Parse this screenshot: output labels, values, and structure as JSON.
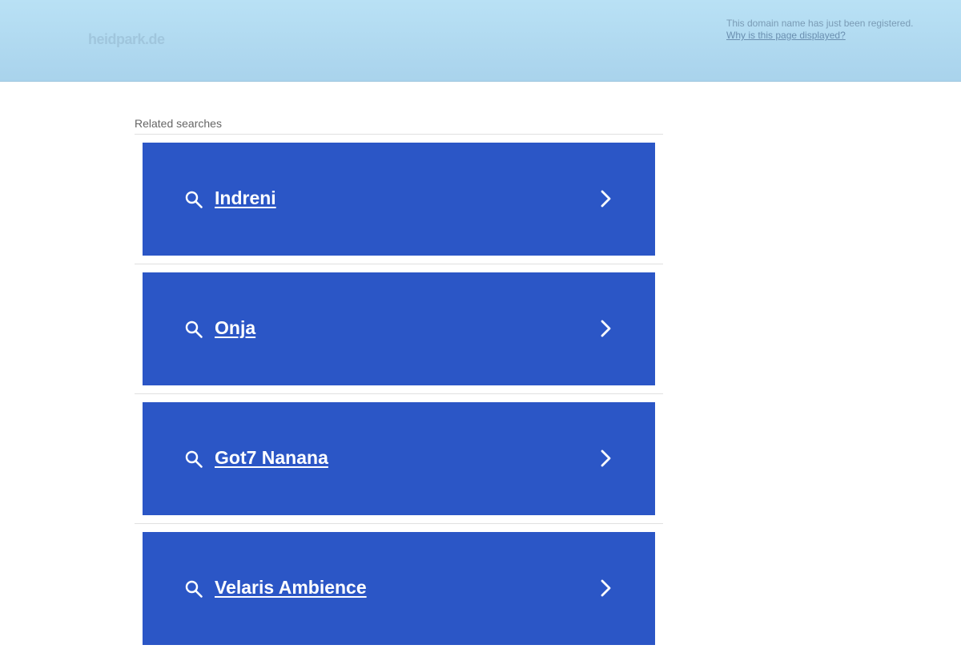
{
  "header": {
    "domain": "heidpark.de",
    "notice": "This domain name has just been registered.",
    "why_link": "Why is this page displayed?"
  },
  "related": {
    "title": "Related searches",
    "items": [
      {
        "label": "Indreni"
      },
      {
        "label": "Onja"
      },
      {
        "label": "Got7 Nanana"
      },
      {
        "label": "Velaris Ambience"
      }
    ]
  },
  "colors": {
    "header_bg": "#b9e1f5",
    "result_bg": "#2b56c6",
    "result_text": "#ffffff"
  },
  "icons": {
    "search": "search-icon",
    "chevron": "chevron-right-icon"
  }
}
